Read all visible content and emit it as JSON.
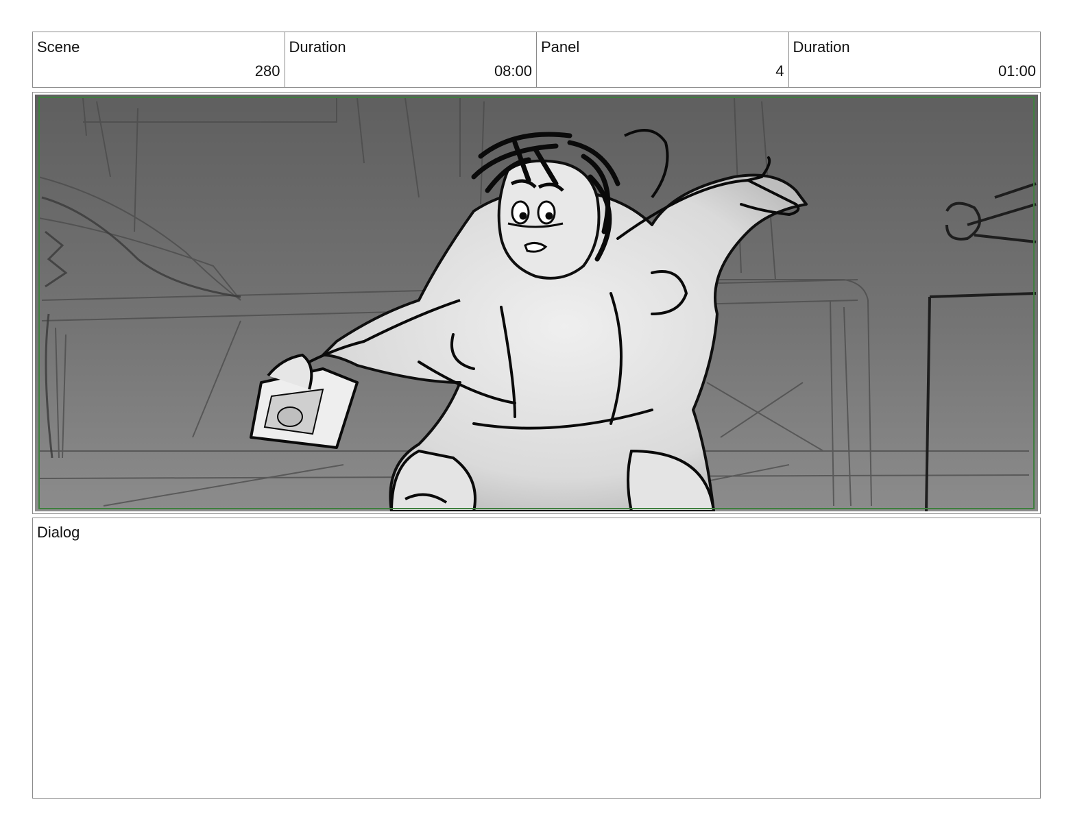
{
  "header": {
    "scene": {
      "label": "Scene",
      "value": "280"
    },
    "scene_duration": {
      "label": "Duration",
      "value": "08:00"
    },
    "panel": {
      "label": "Panel",
      "value": "4"
    },
    "panel_duration": {
      "label": "Duration",
      "value": "01:00"
    }
  },
  "dialog": {
    "label": "Dialog",
    "text": ""
  },
  "colors": {
    "border": "#8a8a8a",
    "safe_frame": "#3f7f3f",
    "background_gray": "#6f6f6f",
    "figure_fill": "#e2e2e2"
  }
}
